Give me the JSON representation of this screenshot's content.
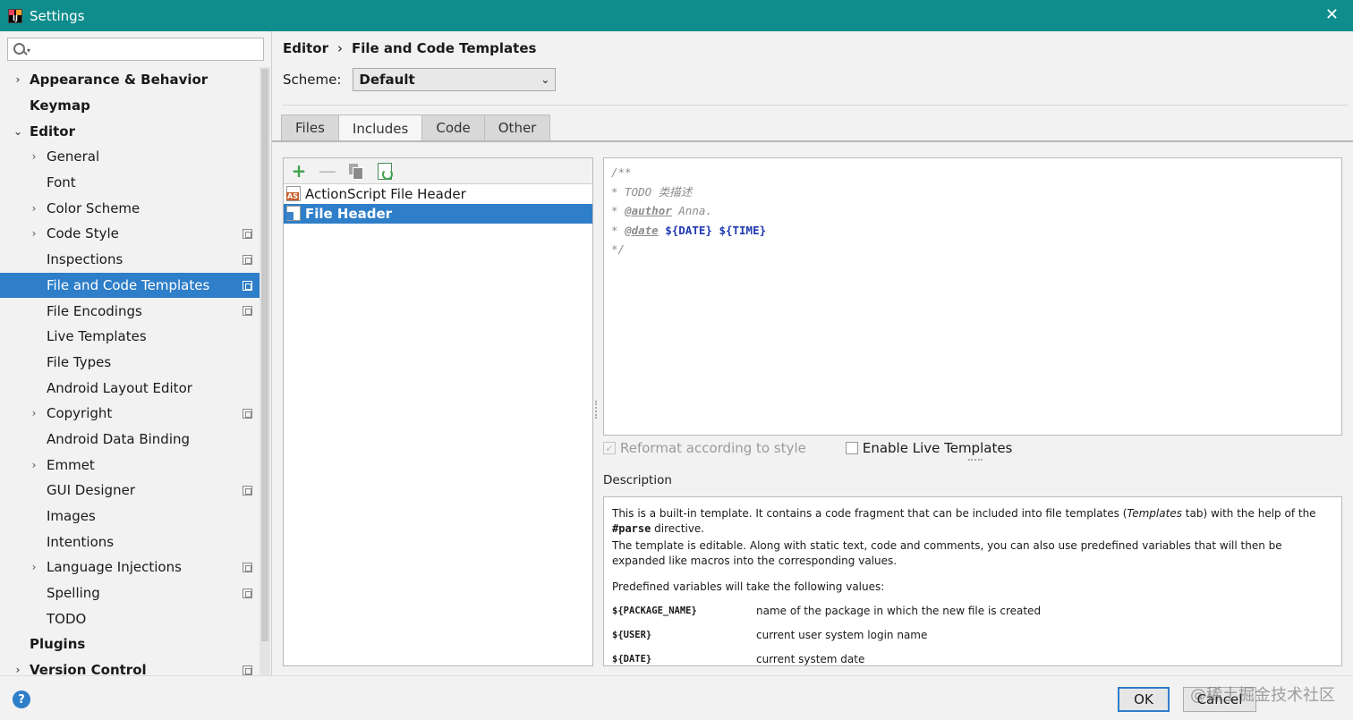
{
  "window": {
    "title": "Settings",
    "close_label": "✕"
  },
  "search": {
    "placeholder": ""
  },
  "sidebar": {
    "items": [
      {
        "label": "Appearance & Behavior",
        "level": 0,
        "bold": true,
        "arrow": "›",
        "copy": false,
        "selected": false
      },
      {
        "label": "Keymap",
        "level": 0,
        "bold": true,
        "arrow": "",
        "copy": false,
        "selected": false
      },
      {
        "label": "Editor",
        "level": 0,
        "bold": true,
        "arrow": "⌄",
        "copy": false,
        "selected": false
      },
      {
        "label": "General",
        "level": 1,
        "bold": false,
        "arrow": "›",
        "copy": false,
        "selected": false
      },
      {
        "label": "Font",
        "level": 1,
        "bold": false,
        "arrow": "",
        "copy": false,
        "selected": false
      },
      {
        "label": "Color Scheme",
        "level": 1,
        "bold": false,
        "arrow": "›",
        "copy": false,
        "selected": false
      },
      {
        "label": "Code Style",
        "level": 1,
        "bold": false,
        "arrow": "›",
        "copy": true,
        "selected": false
      },
      {
        "label": "Inspections",
        "level": 1,
        "bold": false,
        "arrow": "",
        "copy": true,
        "selected": false
      },
      {
        "label": "File and Code Templates",
        "level": 1,
        "bold": false,
        "arrow": "",
        "copy": true,
        "selected": true
      },
      {
        "label": "File Encodings",
        "level": 1,
        "bold": false,
        "arrow": "",
        "copy": true,
        "selected": false
      },
      {
        "label": "Live Templates",
        "level": 1,
        "bold": false,
        "arrow": "",
        "copy": false,
        "selected": false
      },
      {
        "label": "File Types",
        "level": 1,
        "bold": false,
        "arrow": "",
        "copy": false,
        "selected": false
      },
      {
        "label": "Android Layout Editor",
        "level": 1,
        "bold": false,
        "arrow": "",
        "copy": false,
        "selected": false
      },
      {
        "label": "Copyright",
        "level": 1,
        "bold": false,
        "arrow": "›",
        "copy": true,
        "selected": false
      },
      {
        "label": "Android Data Binding",
        "level": 1,
        "bold": false,
        "arrow": "",
        "copy": false,
        "selected": false
      },
      {
        "label": "Emmet",
        "level": 1,
        "bold": false,
        "arrow": "›",
        "copy": false,
        "selected": false
      },
      {
        "label": "GUI Designer",
        "level": 1,
        "bold": false,
        "arrow": "",
        "copy": true,
        "selected": false
      },
      {
        "label": "Images",
        "level": 1,
        "bold": false,
        "arrow": "",
        "copy": false,
        "selected": false
      },
      {
        "label": "Intentions",
        "level": 1,
        "bold": false,
        "arrow": "",
        "copy": false,
        "selected": false
      },
      {
        "label": "Language Injections",
        "level": 1,
        "bold": false,
        "arrow": "›",
        "copy": true,
        "selected": false
      },
      {
        "label": "Spelling",
        "level": 1,
        "bold": false,
        "arrow": "",
        "copy": true,
        "selected": false
      },
      {
        "label": "TODO",
        "level": 1,
        "bold": false,
        "arrow": "",
        "copy": false,
        "selected": false
      },
      {
        "label": "Plugins",
        "level": 0,
        "bold": true,
        "arrow": "",
        "copy": false,
        "selected": false
      },
      {
        "label": "Version Control",
        "level": 0,
        "bold": true,
        "arrow": "›",
        "copy": true,
        "selected": false
      }
    ]
  },
  "breadcrumb": {
    "parent": "Editor",
    "separator": "›",
    "current": "File and Code Templates"
  },
  "scheme": {
    "label": "Scheme:",
    "value": "Default"
  },
  "tabs": [
    {
      "label": "Files",
      "active": false
    },
    {
      "label": "Includes",
      "active": true
    },
    {
      "label": "Code",
      "active": false
    },
    {
      "label": "Other",
      "active": false
    }
  ],
  "templates": [
    {
      "name": "ActionScript File Header",
      "icon": "actionscript-file-icon",
      "badge": "AS",
      "selected": false
    },
    {
      "name": "File Header",
      "icon": "file-header-icon",
      "badge": "",
      "selected": true
    }
  ],
  "editor": {
    "line1": "/**",
    "line2": "* TODO 类描述",
    "line3_star": "* ",
    "line3_tag": "@author",
    "line3_rest": " Anna.",
    "line4_star": "* ",
    "line4_tag": "@date",
    "line4_var1": "${DATE}",
    "line4_var2": "${TIME}",
    "line5": "*/"
  },
  "options": {
    "reformat_label": "Reformat according to style",
    "reformat_checked": true,
    "live_templates_label": "Enable Live Templates",
    "live_templates_checked": false
  },
  "description": {
    "label": "Description",
    "p1_a": "This is a built-in template. It contains a code fragment that can be included into file templates (",
    "p1_em": "Templates",
    "p1_b": " tab) with the help of the ",
    "p1_code": "#parse",
    "p1_c": " directive.",
    "p2": "The template is editable. Along with static text, code and comments, you can also use predefined variables that will then be expanded like macros into the corresponding values.",
    "p3": "Predefined variables will take the following values:",
    "vars": [
      {
        "name": "${PACKAGE_NAME}",
        "desc": "name of the package in which the new file is created"
      },
      {
        "name": "${USER}",
        "desc": "current user system login name"
      },
      {
        "name": "${DATE}",
        "desc": "current system date"
      }
    ]
  },
  "footer": {
    "help": "?",
    "ok": "OK",
    "cancel": "Cancel",
    "watermark": "@稀土掘金技术社区"
  }
}
